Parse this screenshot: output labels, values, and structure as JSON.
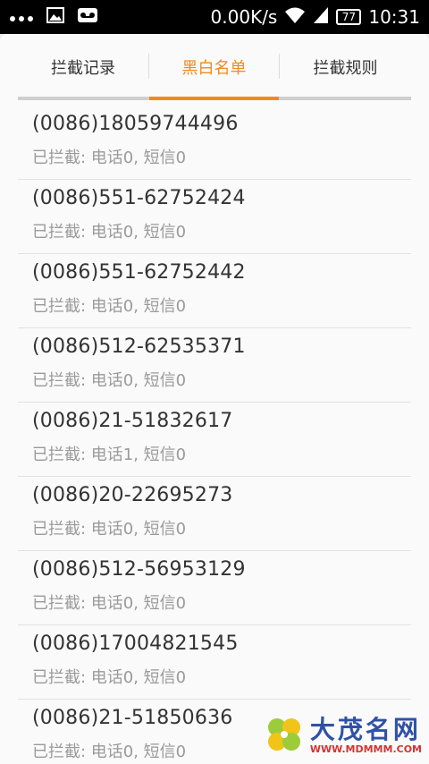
{
  "status_bar": {
    "overflow_icon": "dots-icon",
    "image_icon": "image-icon",
    "voicemail_icon": "voicemail-icon",
    "network_speed": "0.00K/s",
    "wifi_icon": "wifi-icon",
    "signal_icon": "signal-icon",
    "battery_level": "77",
    "time": "10:31"
  },
  "tabs": [
    {
      "label": "拦截记录",
      "active": false
    },
    {
      "label": "黑白名单",
      "active": true
    },
    {
      "label": "拦截规则",
      "active": false
    }
  ],
  "accent_color": "#f18a1c",
  "entries": [
    {
      "number": "(0086)18059744496",
      "stats": "已拦截: 电话0, 短信0"
    },
    {
      "number": "(0086)551-62752424",
      "stats": "已拦截: 电话0, 短信0"
    },
    {
      "number": "(0086)551-62752442",
      "stats": "已拦截: 电话0, 短信0"
    },
    {
      "number": "(0086)512-62535371",
      "stats": "已拦截: 电话0, 短信0"
    },
    {
      "number": "(0086)21-51832617",
      "stats": "已拦截: 电话1, 短信0"
    },
    {
      "number": "(0086)20-22695273",
      "stats": "已拦截: 电话0, 短信0"
    },
    {
      "number": "(0086)512-56953129",
      "stats": "已拦截: 电话0, 短信0"
    },
    {
      "number": "(0086)17004821545",
      "stats": "已拦截: 电话0, 短信0"
    },
    {
      "number": "(0086)21-51850636",
      "stats": "已拦截: 电话0, 短信0"
    }
  ],
  "watermark": {
    "title": "大茂名网",
    "url": "WWW.MDMMM.COM"
  }
}
